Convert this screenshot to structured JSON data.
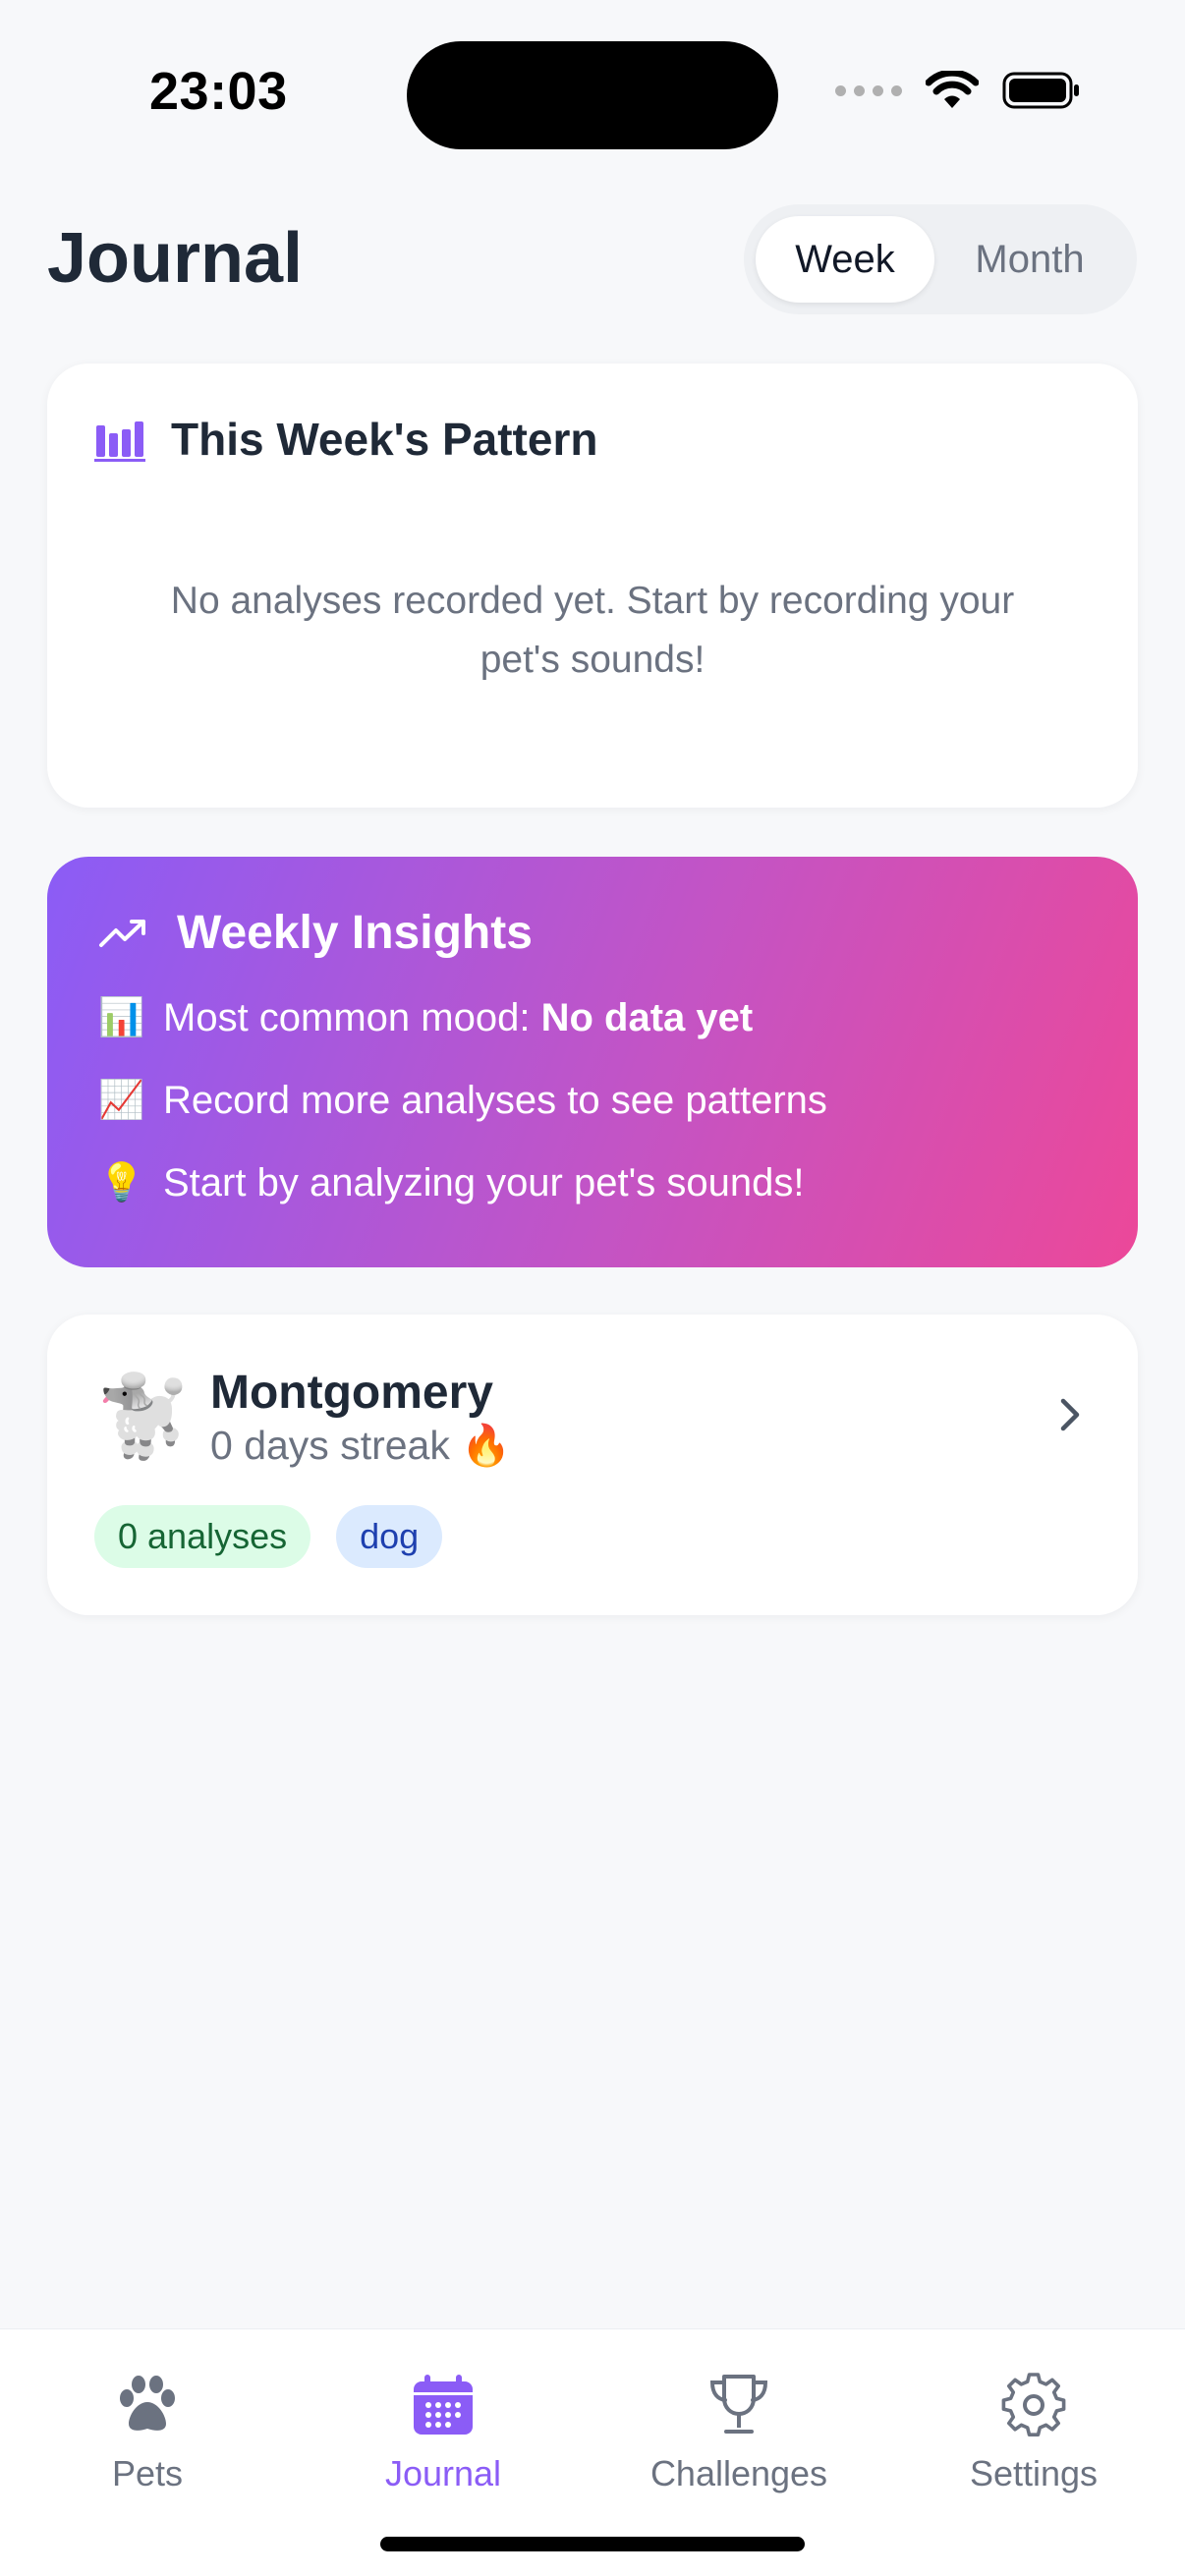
{
  "status_bar": {
    "time": "23:03"
  },
  "header": {
    "title": "Journal",
    "segments": [
      "Week",
      "Month"
    ],
    "selected_segment": "Week"
  },
  "pattern_card": {
    "title": "This Week's Pattern",
    "empty_message": "No analyses recorded yet. Start by recording your pet's sounds!"
  },
  "insights": {
    "title": "Weekly Insights",
    "rows": [
      {
        "emoji": "📊",
        "text": "Most common mood: ",
        "bold": "No data yet"
      },
      {
        "emoji": "📈",
        "text": "Record more analyses to see patterns"
      },
      {
        "emoji": "💡",
        "text": "Start by analyzing your pet's sounds!"
      }
    ]
  },
  "pet": {
    "emoji": "🐩",
    "name": "Montgomery",
    "streak": "0 days streak 🔥",
    "tags": [
      "0 analyses",
      "dog"
    ]
  },
  "tabbar": {
    "items": [
      {
        "label": "Pets",
        "icon": "paw-icon"
      },
      {
        "label": "Journal",
        "icon": "calendar-icon"
      },
      {
        "label": "Challenges",
        "icon": "trophy-icon"
      },
      {
        "label": "Settings",
        "icon": "gear-icon"
      }
    ],
    "active": "Journal"
  },
  "colors": {
    "accent": "#8b5cf6",
    "gradient_start": "#8b5cf6",
    "gradient_end": "#ec4899",
    "tag_green_bg": "#dcfce7",
    "tag_blue_bg": "#dbeafe"
  }
}
